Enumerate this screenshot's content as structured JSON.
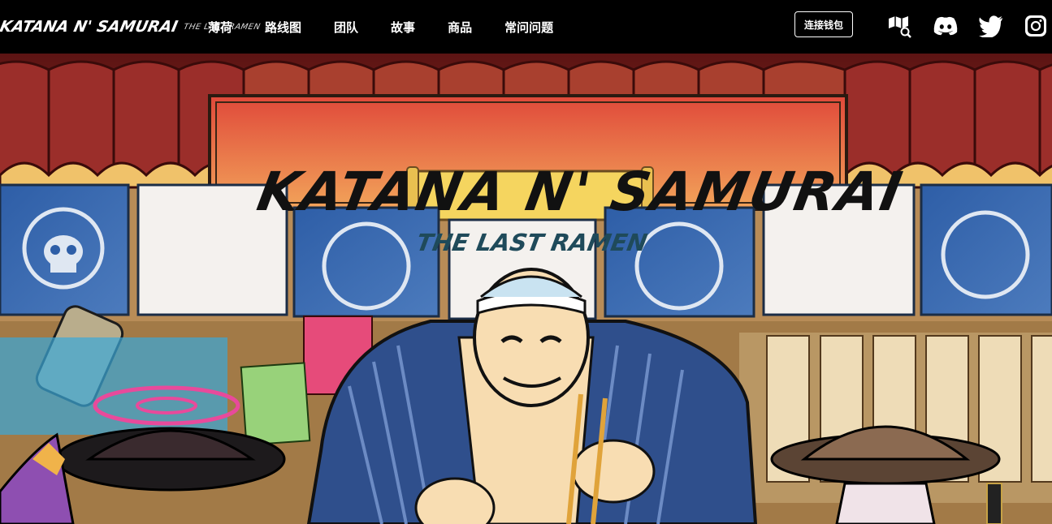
{
  "header": {
    "logo_main": "KATANA N' SAMURAI",
    "logo_sub": "THE LAST RAMEN",
    "nav": [
      {
        "label": "薄荷"
      },
      {
        "label": "路线图"
      },
      {
        "label": "团队"
      },
      {
        "label": "故事"
      },
      {
        "label": "商品"
      },
      {
        "label": "常问问题"
      }
    ],
    "wallet_button": "连接钱包",
    "social_icons": [
      "map-search-icon",
      "discord-icon",
      "twitter-icon",
      "instagram-icon"
    ]
  },
  "hero": {
    "title": "KATANA N' SAMURAI",
    "subtitle": "THE LAST RAMEN"
  },
  "colors": {
    "header_bg": "#000000",
    "header_text": "#ffffff",
    "roof": "#7b1d1b",
    "banner_red": "#e0493a",
    "banner_orange": "#f2a45a",
    "flag_blue": "#3c6aa8",
    "scroll_yellow": "#f5d55f"
  }
}
